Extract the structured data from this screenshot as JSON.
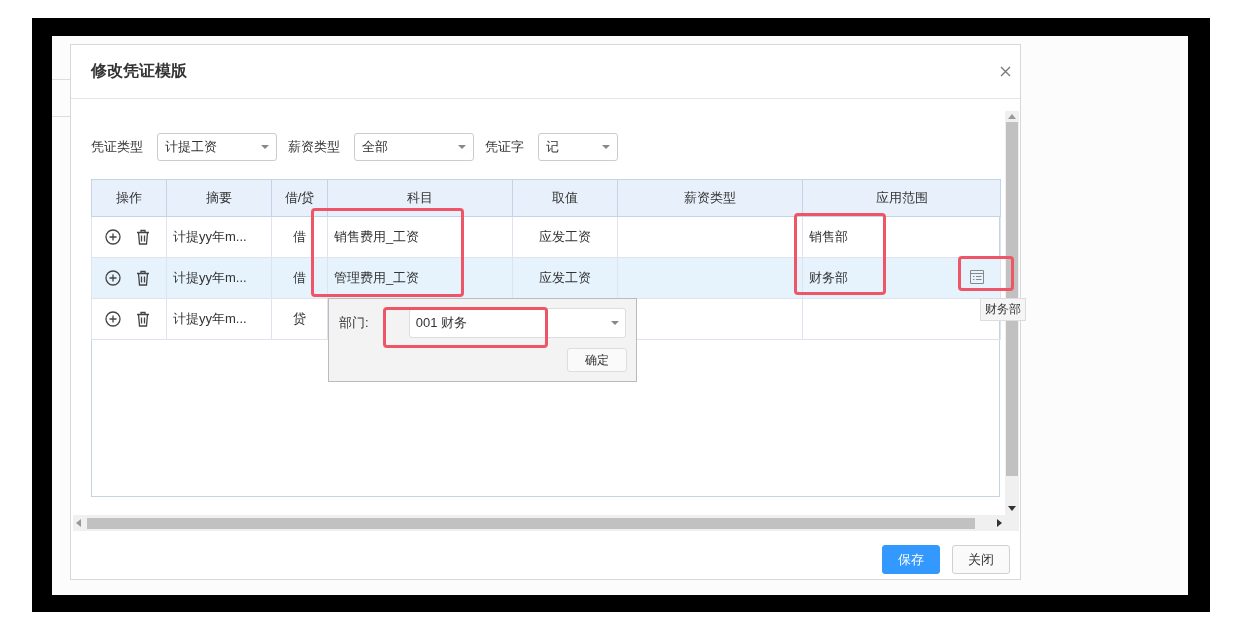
{
  "dialog": {
    "title": "修改凭证模版"
  },
  "filters": [
    {
      "label": "凭证类型",
      "value": "计提工资"
    },
    {
      "label": "薪资类型",
      "value": "全部"
    },
    {
      "label": "凭证字",
      "value": "记"
    }
  ],
  "table": {
    "columns": [
      "操作",
      "摘要",
      "借/贷",
      "科目",
      "取值",
      "薪资类型",
      "应用范围"
    ],
    "rows": [
      {
        "summary": "计提yy年m...",
        "dc": "借",
        "subject": "销售费用_工资",
        "value": "应发工资",
        "scope": "销售部",
        "selected": false
      },
      {
        "summary": "计提yy年m...",
        "dc": "借",
        "subject": "管理费用_工资",
        "value": "应发工资",
        "scope": "财务部",
        "selected": true
      },
      {
        "summary": "计提yy年m...",
        "dc": "贷",
        "selected": false
      }
    ]
  },
  "popup": {
    "label": "部门:",
    "value": "001 财务",
    "button": "确定"
  },
  "tooltip": "财务部",
  "buttons": [
    {
      "label": "保存",
      "kind": "primary"
    },
    {
      "label": "关闭",
      "kind": "default"
    }
  ]
}
